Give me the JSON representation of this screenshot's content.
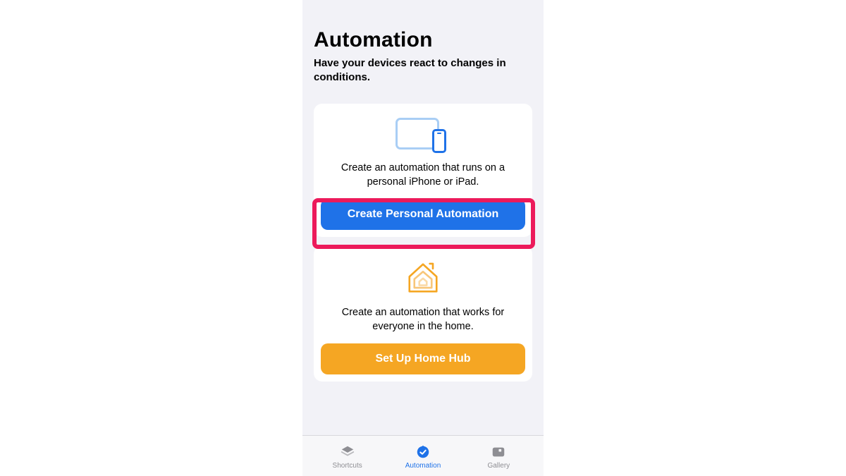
{
  "header": {
    "title": "Automation",
    "subtitle": "Have your devices react to changes in conditions."
  },
  "cards": {
    "personal": {
      "description": "Create an automation that runs on a personal iPhone or iPad.",
      "button_label": "Create Personal Automation"
    },
    "home": {
      "description": "Create an automation that works for everyone in the home.",
      "button_label": "Set Up Home Hub"
    }
  },
  "tabs": {
    "shortcuts": {
      "label": "Shortcuts"
    },
    "automation": {
      "label": "Automation"
    },
    "gallery": {
      "label": "Gallery"
    }
  },
  "colors": {
    "blue": "#1f72e8",
    "orange": "#f5a623",
    "highlight": "#ec1a5b",
    "gray_bg": "#f2f2f7",
    "inactive": "#8e8e93"
  }
}
